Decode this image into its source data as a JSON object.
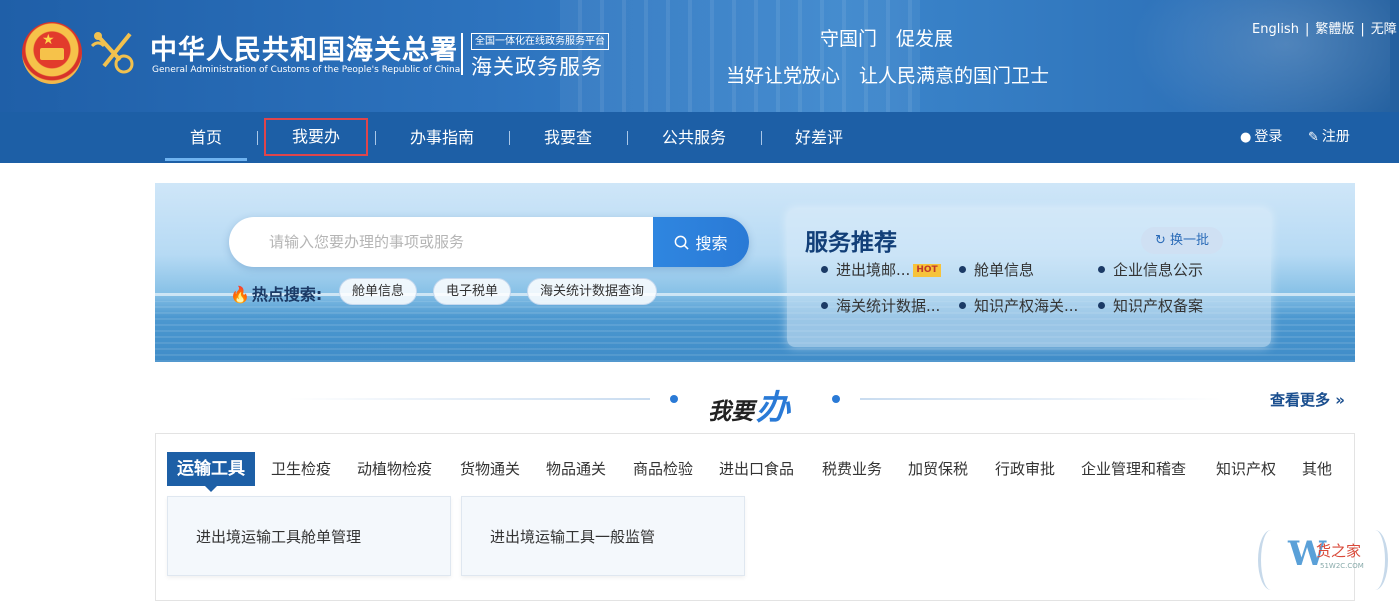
{
  "header": {
    "title_cn": "中华人民共和国海关总署",
    "title_en": "General Administration of Customs of the People's Republic of China",
    "platform_tag": "全国一体化在线政务服务平台",
    "platform_name": "海关政务服务",
    "slogan_line1": "守国门　促发展",
    "slogan_line2": "当好让党放心　让人民满意的国门卫士",
    "lang": {
      "english": "English",
      "traditional": "繁體版",
      "accessible": "无障",
      "sep": "|"
    }
  },
  "nav": {
    "items": [
      "首页",
      "我要办",
      "办事指南",
      "我要查",
      "公共服务",
      "好差评"
    ],
    "login": "登录",
    "register": "注册"
  },
  "banner": {
    "search_placeholder": "请输入您要办理的事项或服务",
    "search_button": "搜索",
    "hot_label": "热点搜索:",
    "hot_tags": [
      "舱单信息",
      "电子税单",
      "海关统计数据查询"
    ],
    "recommend": {
      "title": "服务推荐",
      "refresh": "换一批",
      "hot_badge": "HOT",
      "items": [
        "进出境邮...",
        "舱单信息",
        "企业信息公示",
        "海关统计数据...",
        "知识产权海关...",
        "知识产权备案"
      ]
    }
  },
  "section": {
    "title_small": "我要",
    "title_big": "办",
    "more": "查看更多"
  },
  "categories": {
    "tabs": [
      "运输工具",
      "卫生检疫",
      "动植物检疫",
      "货物通关",
      "物品通关",
      "商品检验",
      "进出口食品",
      "税费业务",
      "加贸保税",
      "行政审批",
      "企业管理和稽查",
      "知识产权",
      "其他"
    ],
    "cards": [
      "进出境运输工具舱单管理",
      "进出境运输工具一般监管"
    ]
  },
  "watermark": {
    "letter": "W",
    "name": "货之家",
    "url": "51W2C.COM"
  },
  "colors": {
    "nav_bg": "#1d5fa6",
    "accent": "#2a7ad6",
    "highlight_box": "#e0454b"
  }
}
